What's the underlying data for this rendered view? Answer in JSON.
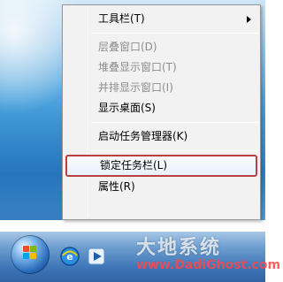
{
  "context_menu": {
    "items": [
      {
        "label": "工具栏(T)",
        "submenu": true,
        "enabled": true
      },
      {
        "label": "层叠窗口(D)",
        "enabled": false
      },
      {
        "label": "堆叠显示窗口(T)",
        "enabled": false
      },
      {
        "label": "并排显示窗口(I)",
        "enabled": false
      },
      {
        "label": "显示桌面(S)",
        "enabled": true
      },
      {
        "label": "启动任务管理器(K)",
        "enabled": true
      },
      {
        "label": "锁定任务栏(L)",
        "enabled": true,
        "highlighted": true
      },
      {
        "label": "属性(R)",
        "enabled": true
      }
    ]
  },
  "taskbar": {
    "icons": [
      "start-button-icon",
      "internet-explorer-icon",
      "media-player-icon"
    ]
  },
  "watermark": {
    "title": "大地系统",
    "url": "www.DadiGhost.com"
  },
  "colors": {
    "menu_bg": "#f2f2f2",
    "highlight_border": "#b9403c",
    "taskbar": "#3f77b8"
  }
}
